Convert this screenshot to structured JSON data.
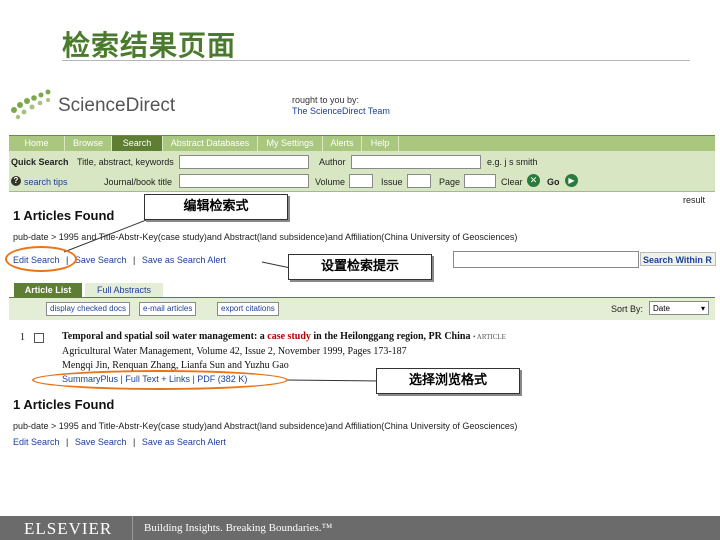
{
  "slide": {
    "title": "检索结果页面"
  },
  "header": {
    "logo_text": "ScienceDirect",
    "brought_line1": "rought to you by:",
    "brought_line2": "The ScienceDirect Team"
  },
  "nav": {
    "tabs": [
      "Home",
      "Browse",
      "Search",
      "Abstract Databases",
      "My Settings",
      "Alerts",
      "Help"
    ],
    "active": "Search"
  },
  "quick_search": {
    "label": "Quick Search",
    "field1": "Title, abstract, keywords",
    "author": "Author",
    "e_g": "e.g. j s smith",
    "search_tips": "search tips",
    "journal": "Journal/book title",
    "volume": "Volume",
    "issue": "Issue",
    "page": "Page",
    "clear": "Clear",
    "go": "Go"
  },
  "results_header": {
    "found": "1 Articles Found",
    "query": "pub-date > 1995 and Title-Abstr-Key(case study)and Abstract(land subsidence)and Affiliation(China University of Geosciences)",
    "edit_search": "Edit Search",
    "save_search": "Save Search",
    "save_alert": "Save as Search Alert",
    "sep": "|",
    "result_label": "result"
  },
  "search_within": {
    "button": "Search Within R"
  },
  "list_tabs": {
    "article_list": "Article List",
    "full_abstracts": "Full Abstracts"
  },
  "toolbar": {
    "display": "display checked docs",
    "email": "e-mail articles",
    "export": "export citations",
    "sort_by": "Sort By:",
    "sort_value": "Date"
  },
  "result": {
    "number": "1",
    "title_pre": "Temporal and spatial soil water management: a ",
    "title_hl": "case study",
    "title_post": " in the Heilonggang region, PR China",
    "type": "ARTICLE",
    "journal": "Agricultural Water Management, Volume 42, Issue 2, November 1999, Pages 173-187",
    "authors": "Mengqi Jin, Renquan Zhang, Lianfa Sun and Yuzhu Gao",
    "links": "SummaryPlus | Full Text + Links | PDF (382 K)"
  },
  "results_footer": {
    "found": "1 Articles Found",
    "query": "pub-date > 1995 and Title-Abstr-Key(case study)and Abstract(land subsidence)and Affiliation(China University of Geosciences)",
    "edit_search": "Edit Search",
    "save_search": "Save Search",
    "save_alert": "Save as Search Alert",
    "sep": "|"
  },
  "callouts": {
    "edit": "编辑检索式",
    "tips": "设置检索提示",
    "format": "选择浏览格式"
  },
  "footer": {
    "brand": "ELSEVIER",
    "tagline": "Building Insights. Breaking Boundaries.™"
  },
  "colors": {
    "title_green": "#4a7a2c",
    "nav_green": "#a9c77f",
    "nav_active": "#5e7e33",
    "highlight": "#e8751a",
    "link_blue": "#1b3f9a",
    "footer_gray": "#6b6b6b"
  }
}
